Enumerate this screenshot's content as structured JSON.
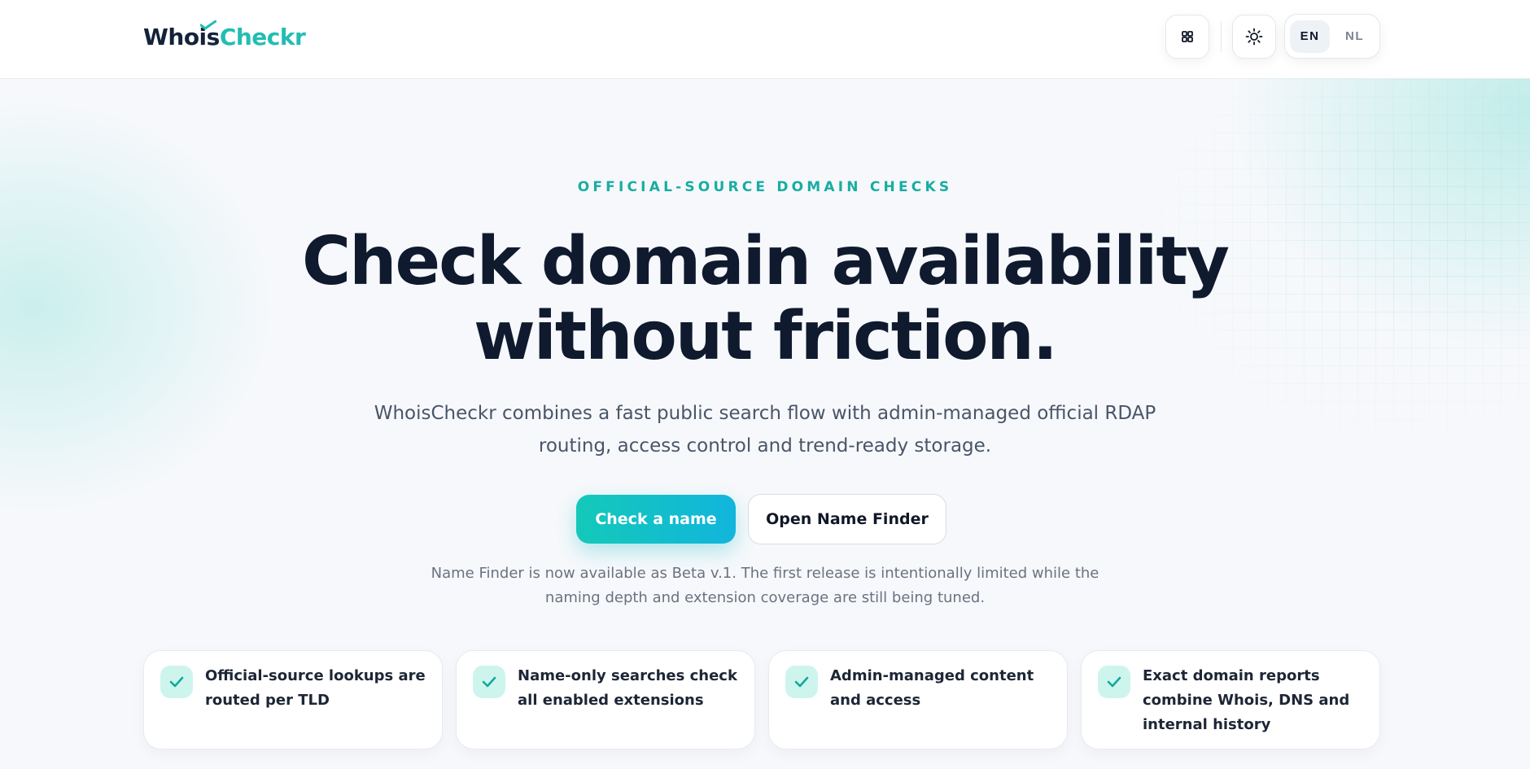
{
  "brand": {
    "name_part1": "Whois",
    "name_part2": "Checkr",
    "accent": "#22bdb2"
  },
  "header": {
    "apps_icon": "grid-icon",
    "theme_icon": "sun-icon",
    "languages": [
      {
        "label": "EN",
        "active": true
      },
      {
        "label": "NL",
        "active": false
      }
    ]
  },
  "hero": {
    "eyebrow": "OFFICIAL-SOURCE DOMAIN CHECKS",
    "headline_line1": "Check domain availability",
    "headline_line2": "without friction.",
    "subtitle": "WhoisCheckr combines a fast public search flow with admin-managed official RDAP routing, access control and trend-ready storage.",
    "primary_cta": "Check a name",
    "secondary_cta": "Open Name Finder",
    "note": "Name Finder is now available as Beta v.1. The first release is intentionally limited while the naming depth and extension coverage are still being tuned."
  },
  "features": [
    {
      "icon": "check-icon",
      "text": "Official-source lookups are routed per TLD"
    },
    {
      "icon": "check-icon",
      "text": "Name-only searches check all enabled extensions"
    },
    {
      "icon": "check-icon",
      "text": "Admin-managed content and access"
    },
    {
      "icon": "check-icon",
      "text": "Exact domain reports combine Whois, DNS and internal history"
    }
  ],
  "colors": {
    "primary_gradient_start": "#13c9b9",
    "primary_gradient_end": "#12b5dc",
    "heading": "#101a2e",
    "eyebrow": "#18ada3"
  }
}
